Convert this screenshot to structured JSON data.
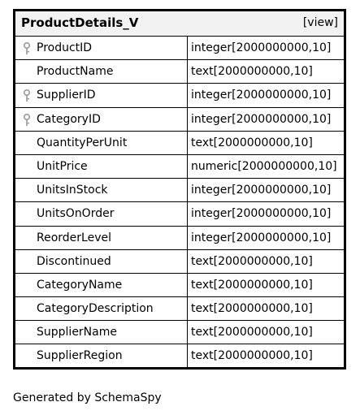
{
  "table": {
    "name": "ProductDetails_V",
    "kind": "[view]",
    "columns": [
      {
        "name": "ProductID",
        "type": "integer[2000000000,10]",
        "key": true
      },
      {
        "name": "ProductName",
        "type": "text[2000000000,10]",
        "key": false
      },
      {
        "name": "SupplierID",
        "type": "integer[2000000000,10]",
        "key": true
      },
      {
        "name": "CategoryID",
        "type": "integer[2000000000,10]",
        "key": true
      },
      {
        "name": "QuantityPerUnit",
        "type": "text[2000000000,10]",
        "key": false
      },
      {
        "name": "UnitPrice",
        "type": "numeric[2000000000,10]",
        "key": false
      },
      {
        "name": "UnitsInStock",
        "type": "integer[2000000000,10]",
        "key": false
      },
      {
        "name": "UnitsOnOrder",
        "type": "integer[2000000000,10]",
        "key": false
      },
      {
        "name": "ReorderLevel",
        "type": "integer[2000000000,10]",
        "key": false
      },
      {
        "name": "Discontinued",
        "type": "text[2000000000,10]",
        "key": false
      },
      {
        "name": "CategoryName",
        "type": "text[2000000000,10]",
        "key": false
      },
      {
        "name": "CategoryDescription",
        "type": "text[2000000000,10]",
        "key": false
      },
      {
        "name": "SupplierName",
        "type": "text[2000000000,10]",
        "key": false
      },
      {
        "name": "SupplierRegion",
        "type": "text[2000000000,10]",
        "key": false
      }
    ]
  },
  "footer": {
    "text": "Generated by SchemaSpy"
  },
  "icons": {
    "key": "key-icon"
  },
  "colors": {
    "header_bg": "#f2f2f2",
    "key_icon": "#999999"
  }
}
